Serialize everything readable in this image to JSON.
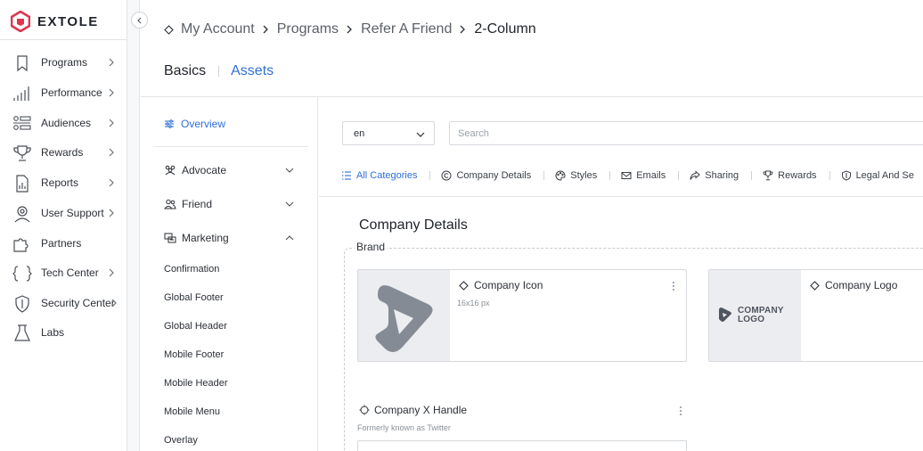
{
  "brand": {
    "name": "EXTOLE",
    "accent": "#e0334f",
    "link_color": "#2f6fd6"
  },
  "sidebar": {
    "items": [
      {
        "label": "Programs",
        "icon": "bookmark-icon",
        "has_chevron": true
      },
      {
        "label": "Performance",
        "icon": "bar-chart-icon",
        "has_chevron": true
      },
      {
        "label": "Audiences",
        "icon": "audience-icon",
        "has_chevron": true
      },
      {
        "label": "Rewards",
        "icon": "trophy-icon",
        "has_chevron": true
      },
      {
        "label": "Reports",
        "icon": "report-icon",
        "has_chevron": true
      },
      {
        "label": "User Support",
        "icon": "support-icon",
        "has_chevron": true
      },
      {
        "label": "Partners",
        "icon": "puzzle-icon",
        "has_chevron": false
      },
      {
        "label": "Tech Center",
        "icon": "braces-icon",
        "has_chevron": true
      },
      {
        "label": "Security Center",
        "icon": "shield-icon",
        "has_chevron": true
      },
      {
        "label": "Labs",
        "icon": "flask-icon",
        "has_chevron": false
      }
    ]
  },
  "header": {
    "breadcrumb": [
      "My Account",
      "Programs",
      "Refer A Friend",
      "2-Column"
    ],
    "tabs": [
      {
        "label": "Basics",
        "active": false
      },
      {
        "label": "Assets",
        "active": true
      }
    ]
  },
  "tree": {
    "overview": "Overview",
    "groups": [
      {
        "label": "Advocate",
        "expanded": false
      },
      {
        "label": "Friend",
        "expanded": false
      },
      {
        "label": "Marketing",
        "expanded": true
      }
    ],
    "marketing_items": [
      "Confirmation",
      "Global Footer",
      "Global Header",
      "Mobile Footer",
      "Mobile Header",
      "Mobile Menu",
      "Overlay"
    ]
  },
  "filters": {
    "language": "en",
    "search_placeholder": "Search",
    "categories": [
      {
        "label": "All Categories",
        "icon": "list-icon",
        "active": true
      },
      {
        "label": "Company Details",
        "icon": "copyright-icon",
        "active": false
      },
      {
        "label": "Styles",
        "icon": "palette-icon",
        "active": false
      },
      {
        "label": "Emails",
        "icon": "mail-icon",
        "active": false
      },
      {
        "label": "Sharing",
        "icon": "share-icon",
        "active": false
      },
      {
        "label": "Rewards",
        "icon": "trophy-icon",
        "active": false
      },
      {
        "label": "Legal And Se",
        "icon": "shield-icon",
        "active": false
      }
    ]
  },
  "content": {
    "section_title": "Company Details",
    "group_label": "Brand",
    "cards": [
      {
        "title": "Company Icon",
        "subtitle": "16x16 px"
      },
      {
        "title": "Company Logo",
        "subtitle": "",
        "logo_text_1": "COMPANY",
        "logo_text_2": "LOGO"
      }
    ],
    "handle": {
      "title": "Company X Handle",
      "subtitle": "Formerly known as Twitter"
    }
  }
}
